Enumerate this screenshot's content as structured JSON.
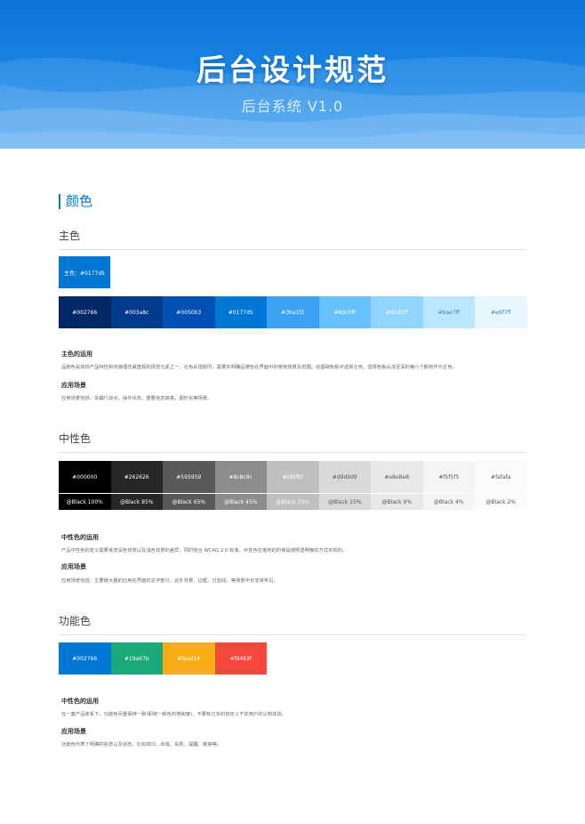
{
  "banner": {
    "title": "后台设计规范",
    "subtitle": "后台系统 V1.0"
  },
  "section_title": "颜色",
  "primary": {
    "heading": "主色",
    "main_chip": "主色：#0177d5",
    "swatches": [
      {
        "label": "#002766",
        "color": "#002766",
        "text": "#ffffff"
      },
      {
        "label": "#003a8c",
        "color": "#003a8c",
        "text": "#ffffff"
      },
      {
        "label": "#0050b3",
        "color": "#0050b3",
        "text": "#ffffff"
      },
      {
        "label": "#0177d5",
        "color": "#0177d5",
        "text": "#ffffff"
      },
      {
        "label": "#3ba1f2",
        "color": "#3ba1f2",
        "text": "#ffffff"
      },
      {
        "label": "#69c0ff",
        "color": "#69c0ff",
        "text": "#ffffff"
      },
      {
        "label": "#91d5ff",
        "color": "#91d5ff",
        "text": "#ffffff"
      },
      {
        "label": "#bae7ff",
        "color": "#bae7ff",
        "text": "#4a7db0"
      },
      {
        "label": "#e6f7ff",
        "color": "#e6f7ff",
        "text": "#4a7db0"
      }
    ],
    "usage_heading": "主色的运用",
    "usage_text": "品牌色是体现产品特性和传播理念最直观的视觉元素之一。在色彩选取时，需要先明确品牌色在界面中的使用场景及范围。在基础色板中选择主色。选择色板从浅至深的第六个颜色作为主色。",
    "scene_heading": "应用场景",
    "scene_text": "应用场景包括：关键行动点，操作状态、重要信息高亮，图形化等场景。"
  },
  "neutral": {
    "heading": "中性色",
    "swatches": [
      {
        "label": "#000000",
        "color": "#000000",
        "text": "#ffffff",
        "alpha": "@Black 100%"
      },
      {
        "label": "#262626",
        "color": "#262626",
        "text": "#ffffff",
        "alpha": "@Black 85%"
      },
      {
        "label": "#595959",
        "color": "#595959",
        "text": "#ffffff",
        "alpha": "@Black 65%"
      },
      {
        "label": "#8c8c8c",
        "color": "#8c8c8c",
        "text": "#ffffff",
        "alpha": "@Black 45%"
      },
      {
        "label": "#bfbfbf",
        "color": "#bfbfbf",
        "text": "#ffffff",
        "alpha": "@Black 25%"
      },
      {
        "label": "#d9d9d9",
        "color": "#d9d9d9",
        "text": "#555555",
        "alpha": "@Black 15%"
      },
      {
        "label": "#e8e8e8",
        "color": "#e8e8e8",
        "text": "#555555",
        "alpha": "@Black 9%"
      },
      {
        "label": "#f5f5f5",
        "color": "#f5f5f5",
        "text": "#555555",
        "alpha": "@Black 4%"
      },
      {
        "label": "#fafafa",
        "color": "#fafafa",
        "text": "#555555",
        "alpha": "@Black 2%"
      }
    ],
    "usage_heading": "中性色的运用",
    "usage_text": "产品中性色的定义需要考虑深色背景以及浅色背景的差异，同时结合 WCAG 2.0 标准。中性色在落地的时候是按照透明度的方式实现的。",
    "scene_heading": "应用场景",
    "scene_text": "应用场景包括：主要被大量的应用在界面的文字部分，此外背景、边框、分割线、等场景中也非常常见。"
  },
  "functional": {
    "heading": "功能色",
    "swatches": [
      {
        "label": "#002766",
        "color": "#0177d5",
        "text": "#ffffff"
      },
      {
        "label": "#19a97b",
        "color": "#19a97b",
        "text": "#ffffff"
      },
      {
        "label": "#faad14",
        "color": "#faad14",
        "text": "#ffffff"
      },
      {
        "label": "#f9463f",
        "color": "#f9463f",
        "text": "#ffffff"
      }
    ],
    "usage_heading": "中性色的运用",
    "usage_text": "在一套产品体系下，功能色尽量保持一致(即统一颜色的饱和度)，不要有过多的自定义干扰用户的认知体验。",
    "scene_heading": "应用场景",
    "scene_text": "功能色代表了明确的信息以及状态，比如成功、出错、失败、提醒、链接等。"
  }
}
